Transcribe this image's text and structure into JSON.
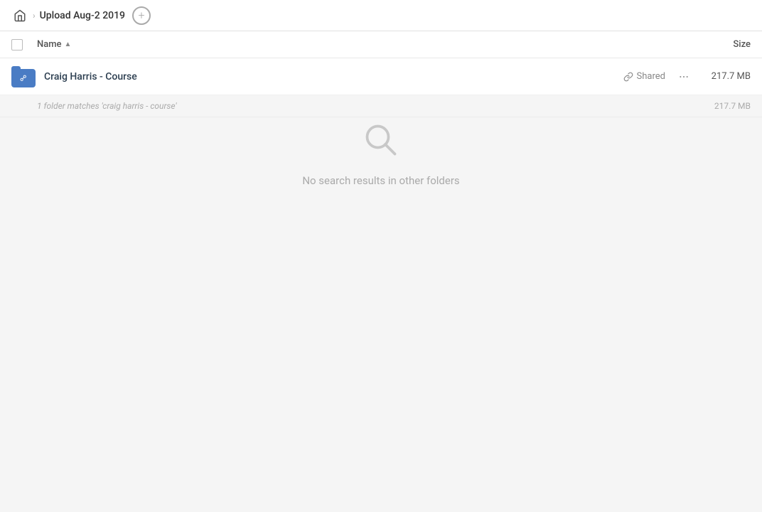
{
  "header": {
    "home_label": "home",
    "breadcrumb_label": "Upload Aug-2 2019",
    "add_button_label": "+"
  },
  "table": {
    "name_column": "Name",
    "size_column": "Size"
  },
  "files": [
    {
      "name": "Craig Harris - Course",
      "shared_label": "Shared",
      "size": "217.7 MB",
      "icon_type": "folder-link"
    }
  ],
  "summary": {
    "text": "1 folder matches 'craig harris - course'",
    "size": "217.7 MB"
  },
  "empty_state": {
    "message": "No search results in other folders"
  },
  "icons": {
    "home": "🏠",
    "link": "🔗",
    "more": "•••"
  }
}
